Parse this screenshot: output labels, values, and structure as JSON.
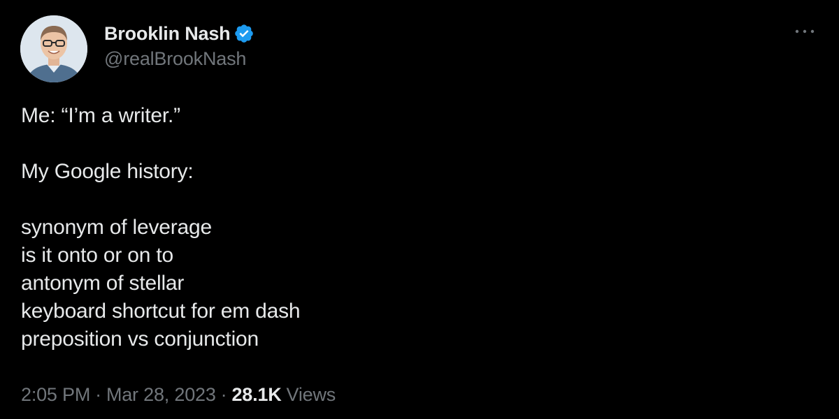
{
  "author": {
    "display_name": "Brooklin Nash",
    "handle": "@realBrookNash",
    "verified": true,
    "verified_color": "#1d9bf0"
  },
  "tweet": {
    "lines": [
      "Me: “I’m a writer.”",
      "",
      "My Google history:",
      "",
      "synonym of leverage",
      "is it onto or on to",
      "antonym of stellar",
      "keyboard shortcut for em dash",
      "preposition vs conjunction"
    ]
  },
  "meta": {
    "time": "2:05 PM",
    "separator": "·",
    "date": "Mar 28, 2023",
    "views_count": "28.1K",
    "views_label": "Views"
  },
  "icons": {
    "more": "more-horizontal-icon",
    "verified": "verified-badge-icon"
  },
  "colors": {
    "background": "#000000",
    "text_primary": "#e7e9ea",
    "text_secondary": "#71767b",
    "accent": "#1d9bf0"
  }
}
